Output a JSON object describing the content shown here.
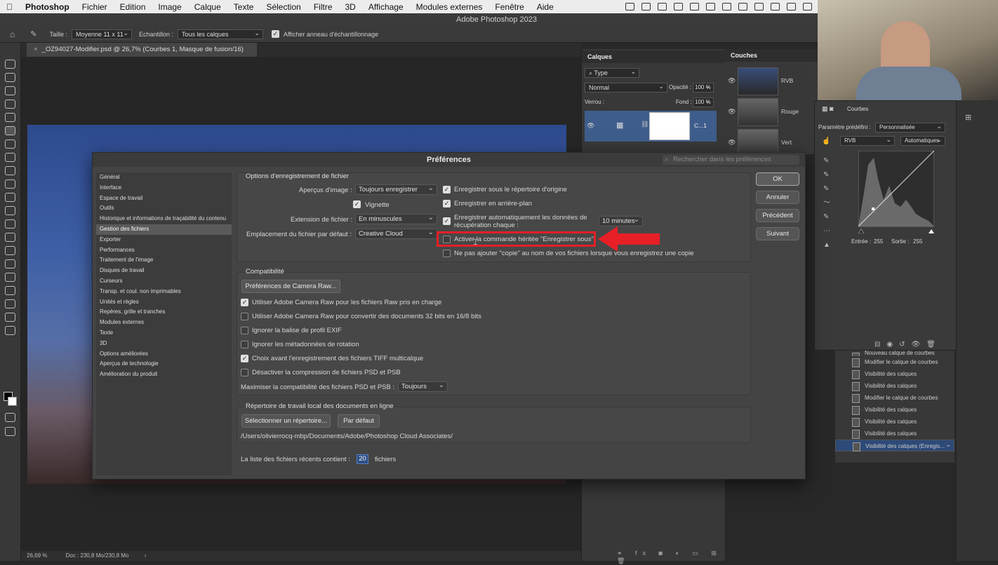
{
  "menubar": {
    "apple": "",
    "items": [
      "Photoshop",
      "Fichier",
      "Edition",
      "Image",
      "Calque",
      "Texte",
      "Sélection",
      "Filtre",
      "3D",
      "Affichage",
      "Modules externes",
      "Fenêtre",
      "Aide"
    ]
  },
  "window_title": "Adobe Photoshop 2023",
  "options_bar": {
    "size_label": "Taille :",
    "size_value": "Moyenne 11 x 11",
    "sample_label": "Echantillon :",
    "sample_value": "Tous les calques",
    "ring_label": "Afficher anneau d'échantillonnage"
  },
  "document_tab": "_OZ94027-Modifier.psd @ 26,7% (Courbes 1, Masque de fusion/16)",
  "status": {
    "zoom": "26,69 %",
    "doc": "Doc : 230,8 Mo/230,8 Mo"
  },
  "layers_panel": {
    "title": "Calques",
    "filter": "Type",
    "blend": "Normal",
    "opacity_label": "Opacité :",
    "opacity": "100 %",
    "lock_label": "Verrou :",
    "fill_label": "Fond :",
    "fill": "100 %",
    "layer_name": "C...1"
  },
  "channels_panel": {
    "title": "Couches",
    "channels": [
      "RVB",
      "Rouge",
      "Vert"
    ]
  },
  "properties_panel": {
    "title": "Courbes",
    "preset_label": "Paramètre prédéfini :",
    "preset": "Personnalisée",
    "channel": "RVB",
    "auto": "Automatiques",
    "input_label": "Entrée :",
    "input": "255",
    "output_label": "Sortie :",
    "output": "255"
  },
  "history": [
    "Nouveau calque de courbes",
    "Modifier le calque de courbes",
    "Visibilité des calques",
    "Visibilité des calques",
    "Modifier le calque de courbes",
    "Visibilité des calques",
    "Visibilité des calques",
    "Visibilité des calques",
    "Visibilité des calques (Enregis..."
  ],
  "dialog": {
    "title": "Préférences",
    "search_placeholder": "Rechercher dans les préférences",
    "nav": [
      "Général",
      "Interface",
      "Espace de travail",
      "Outils",
      "Historique et informations de traçabilité du contenu",
      "Gestion des fichiers",
      "Exporter",
      "Performances",
      "Traitement de l'image",
      "Disques de travail",
      "Curseurs",
      "Transp. et coul. non imprimables",
      "Unités et règles",
      "Repères, grille et tranches",
      "Modules externes",
      "Texte",
      "3D",
      "Options améliorées",
      "Aperçus de technologie",
      "Amélioration du produit"
    ],
    "buttons": {
      "ok": "OK",
      "cancel": "Annuler",
      "prev": "Précédent",
      "next": "Suivant"
    },
    "save_options": {
      "title": "Options d'enregistrement de fichier",
      "preview_label": "Aperçus d'image :",
      "preview_value": "Toujours enregistrer",
      "thumbnail": "Vignette",
      "ext_label": "Extension de fichier :",
      "ext_value": "En minuscules",
      "location_label": "Emplacement du fichier par défaut :",
      "location_value": "Creative Cloud",
      "save_original": "Enregistrer sous le répertoire d'origine",
      "save_background": "Enregistrer en arrière-plan",
      "autosave_1": "Enregistrer automatiquement les données de",
      "autosave_2": "récupération chaque :",
      "autosave_value": "10 minutes",
      "legacy_save_as": "Activer la commande héritée \"Enregistrer sous\"",
      "no_copy": "Ne pas ajouter \"copie\" au nom de vos fichiers lorsque vous enregistrez une copie"
    },
    "compat": {
      "title": "Compatibilité",
      "camera_raw_button": "Préférences de Camera Raw...",
      "opt1": "Utiliser Adobe Camera Raw pour les fichiers Raw pris en charge",
      "opt2": "Utiliser Adobe Camera Raw pour convertir des documents 32 bits en 16/8 bits",
      "opt3": "Ignorer la balise de profil EXIF",
      "opt4": "Ignorer les métadonnées de rotation",
      "opt5": "Choix avant l'enregistrement des fichiers TIFF multicalque",
      "opt6": "Désactiver la compression de fichiers PSD et PSB",
      "max_label": "Maximiser la compatibilité des fichiers PSD et PSB :",
      "max_value": "Toujours"
    },
    "workdir": {
      "title": "Répertoire de travail local des documents en ligne",
      "select_button": "Sélectionner un répertoire...",
      "default_button": "Par défaut",
      "path": "/Users/olivierrocq-mbp/Documents/Adobe/Photoshop Cloud Associates/"
    },
    "recent_label": "La liste des fichiers récents contient :",
    "recent_value": "20",
    "recent_unit": "fichiers"
  },
  "colors": {
    "highlight": "#e81f26",
    "selection": "#2d4a78"
  }
}
